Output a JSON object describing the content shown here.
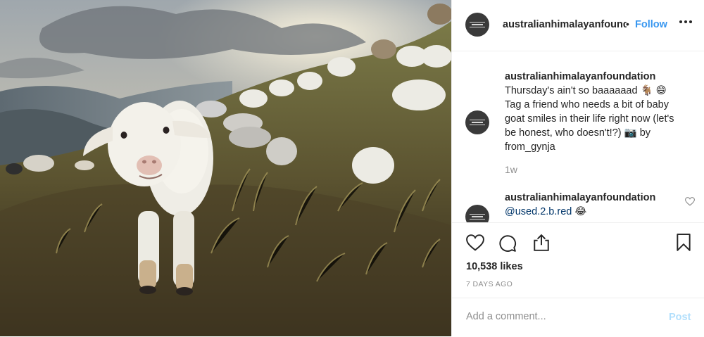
{
  "header": {
    "username": "australianhimalayanfoundation",
    "separator": "•",
    "follow_label": "Follow",
    "more_icon": "more-horizontal-icon",
    "more_label": "•••"
  },
  "caption": {
    "username": "australianhimalayanfoundation",
    "text_line1": "Thursday's ain't so baaaaaad 🐐 😄",
    "text_rest": "Tag a friend who needs a bit of baby goat smiles in their life right now (let's be honest, who doesn't!?) 📷 by from_gynja",
    "time": "1w"
  },
  "comments": [
    {
      "username": "australianhimalayanfoundation",
      "mention": "@used.2.b.red",
      "emoji": "😂"
    }
  ],
  "actions": {
    "like_icon": "heart-icon",
    "comment_icon": "comment-icon",
    "share_icon": "share-icon",
    "save_icon": "bookmark-icon"
  },
  "likes": "10,538 likes",
  "age": "7 DAYS AGO",
  "add_comment": {
    "placeholder": "Add a comment...",
    "post_label": "Post"
  },
  "colors": {
    "accent": "#3897f0",
    "post_disabled": "#b2dffc",
    "muted": "#8e8e8e",
    "text": "#262626"
  }
}
